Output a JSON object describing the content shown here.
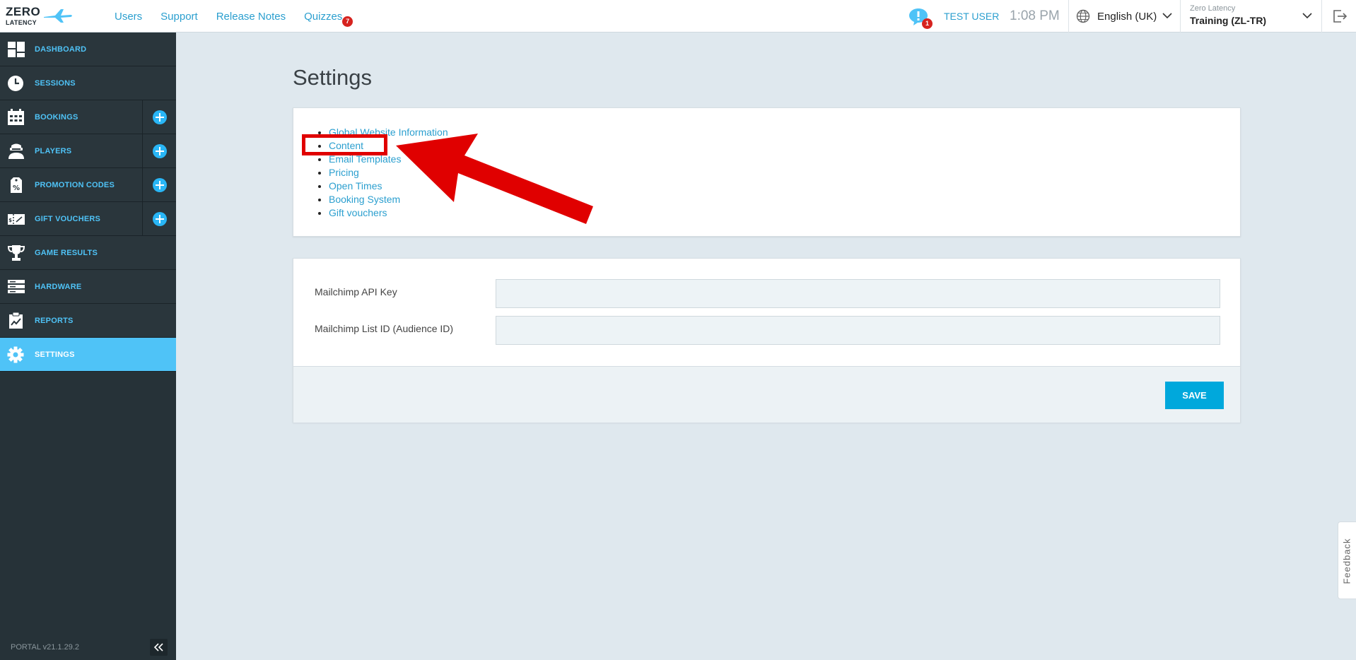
{
  "brand": {
    "logo_line1": "ZERO",
    "logo_line2": "LATENCY"
  },
  "topnav": [
    {
      "label": "Users"
    },
    {
      "label": "Support"
    },
    {
      "label": "Release Notes"
    },
    {
      "label": "Quizzes",
      "badge": "7"
    }
  ],
  "header": {
    "notifications_badge": "1",
    "username": "TEST USER",
    "time": "1:08 PM",
    "language": "English (UK)",
    "org_small": "Zero Latency",
    "org_main": "Training (ZL-TR)"
  },
  "sidebar": {
    "items": [
      {
        "label": "DASHBOARD",
        "icon": "dashboard-icon"
      },
      {
        "label": "SESSIONS",
        "icon": "clock-icon"
      },
      {
        "label": "BOOKINGS",
        "icon": "calendar-icon",
        "add": true
      },
      {
        "label": "PLAYERS",
        "icon": "player-icon",
        "add": true
      },
      {
        "label": "PROMOTION CODES",
        "icon": "promo-tag-icon",
        "add": true
      },
      {
        "label": "GIFT VOUCHERS",
        "icon": "voucher-icon",
        "add": true
      },
      {
        "label": "GAME RESULTS",
        "icon": "trophy-icon"
      },
      {
        "label": "HARDWARE",
        "icon": "server-icon"
      },
      {
        "label": "REPORTS",
        "icon": "report-icon"
      },
      {
        "label": "SETTINGS",
        "icon": "gear-icon",
        "active": true
      }
    ],
    "version": "PORTAL v21.1.29.2"
  },
  "main": {
    "title": "Settings",
    "links": [
      "Global Website Information",
      "Content",
      "Email Templates",
      "Pricing",
      "Open Times",
      "Booking System",
      "Gift vouchers"
    ],
    "form": {
      "api_key_label": "Mailchimp API Key",
      "api_key_value": "",
      "list_id_label": "Mailchimp List ID (Audience ID)",
      "list_id_value": "",
      "save_label": "SAVE"
    }
  },
  "feedback_label": "Feedback",
  "colors": {
    "accent": "#4fc3f7",
    "link": "#2b9fcf",
    "sidebar_bg": "#263238",
    "save_button": "#00a8dc",
    "annotation_red": "#e00000"
  }
}
